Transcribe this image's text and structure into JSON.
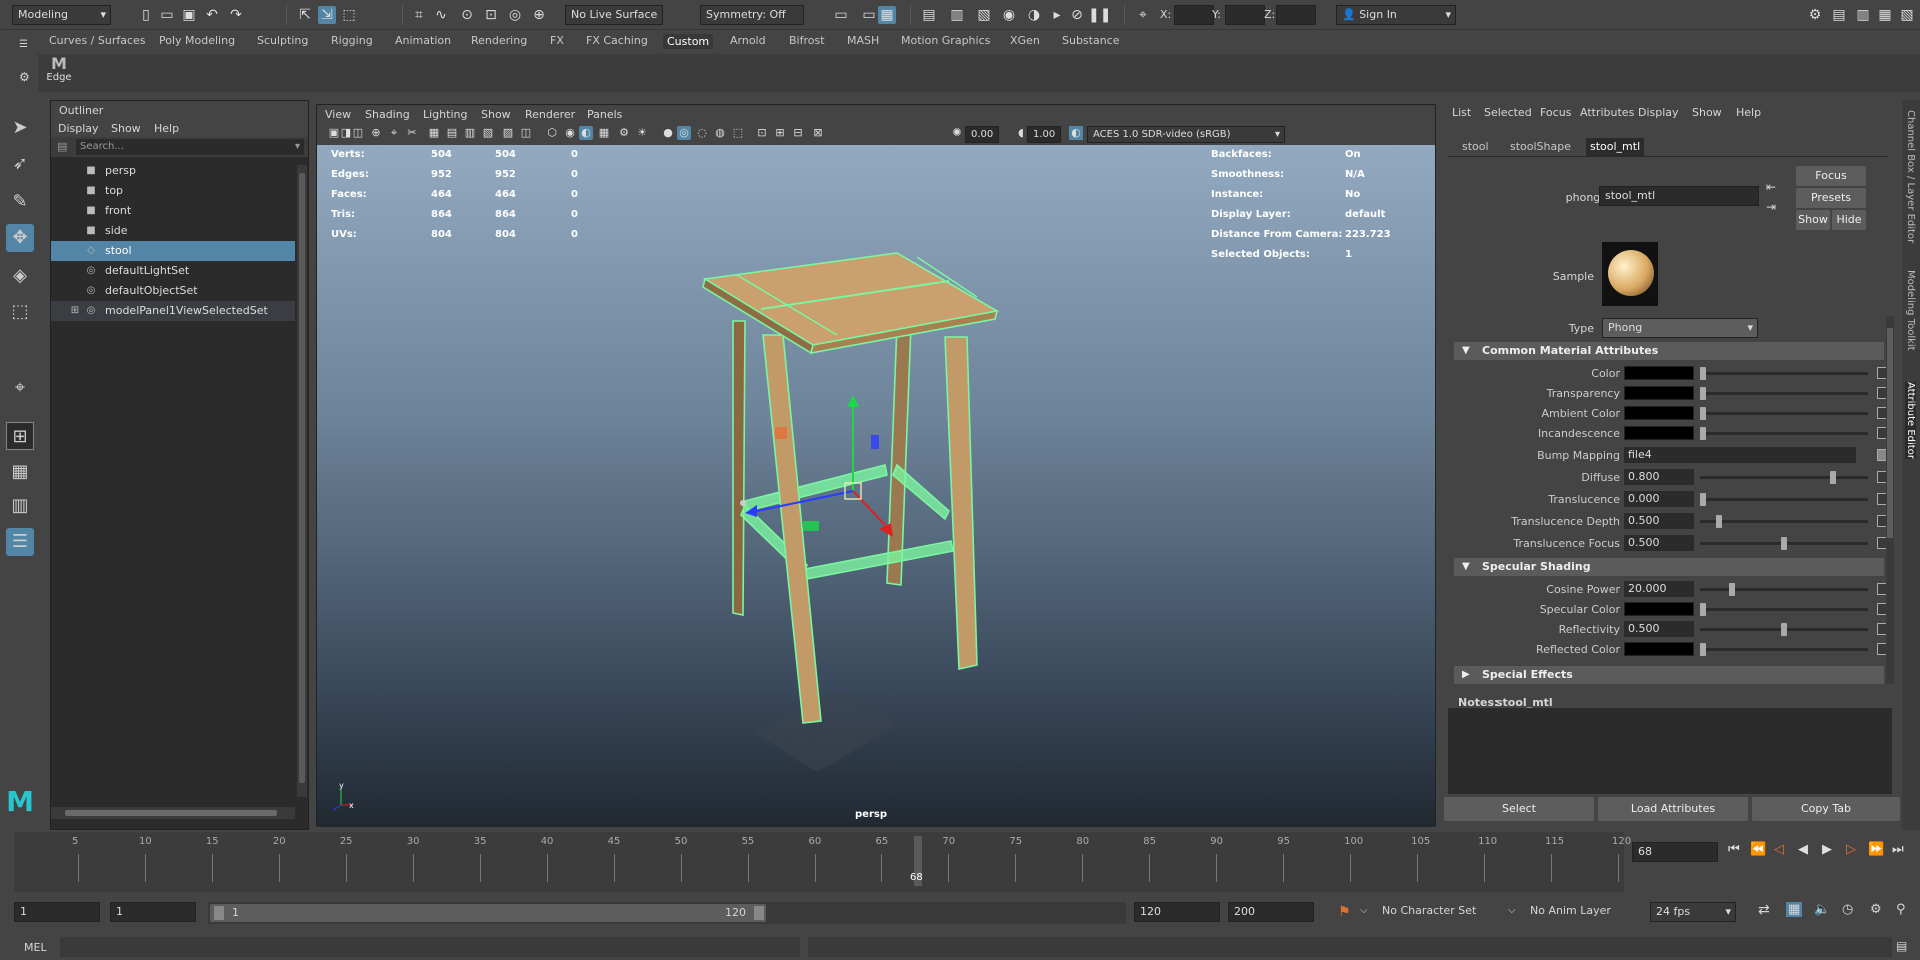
{
  "status_line": {
    "menu_set": "Modeling",
    "live_surface": "No Live Surface",
    "symmetry": "Symmetry: Off",
    "x_label": "X:",
    "y_label": "Y:",
    "z_label": "Z:",
    "sign_in": "Sign In"
  },
  "shelf": {
    "tabs": [
      "Curves / Surfaces",
      "Poly Modeling",
      "Sculpting",
      "Rigging",
      "Animation",
      "Rendering",
      "FX",
      "FX Caching",
      "Custom",
      "Arnold",
      "Bifrost",
      "MASH",
      "Motion Graphics",
      "XGen",
      "Substance"
    ],
    "active_tab": "Custom",
    "edge_button": "Edge"
  },
  "outliner": {
    "title": "Outliner",
    "menu": [
      "Display",
      "Show",
      "Help"
    ],
    "search_placeholder": "Search...",
    "items": [
      {
        "label": "persp",
        "icon": "camera-icon"
      },
      {
        "label": "top",
        "icon": "camera-icon"
      },
      {
        "label": "front",
        "icon": "camera-icon"
      },
      {
        "label": "side",
        "icon": "camera-icon"
      },
      {
        "label": "stool",
        "icon": "mesh-icon"
      },
      {
        "label": "defaultLightSet",
        "icon": "set-icon"
      },
      {
        "label": "defaultObjectSet",
        "icon": "set-icon"
      },
      {
        "label": "modelPanel1ViewSelectedSet",
        "icon": "set-icon"
      }
    ],
    "selected": "stool"
  },
  "viewport": {
    "menu": [
      "View",
      "Shading",
      "Lighting",
      "Show",
      "Renderer",
      "Panels"
    ],
    "exposure": "0.00",
    "gamma": "1.00",
    "color_space": "ACES 1.0 SDR-video (sRGB)",
    "camera": "persp",
    "hud_left": [
      {
        "label": "Verts:",
        "a": "504",
        "b": "504",
        "c": "0"
      },
      {
        "label": "Edges:",
        "a": "952",
        "b": "952",
        "c": "0"
      },
      {
        "label": "Faces:",
        "a": "464",
        "b": "464",
        "c": "0"
      },
      {
        "label": "Tris:",
        "a": "864",
        "b": "864",
        "c": "0"
      },
      {
        "label": "UVs:",
        "a": "804",
        "b": "804",
        "c": "0"
      }
    ],
    "hud_right": [
      {
        "label": "Backfaces:",
        "value": "On"
      },
      {
        "label": "Smoothness:",
        "value": "N/A"
      },
      {
        "label": "Instance:",
        "value": "No"
      },
      {
        "label": "Display Layer:",
        "value": "default"
      },
      {
        "label": "Distance From Camera:",
        "value": "223.723"
      },
      {
        "label": "Selected Objects:",
        "value": "1"
      }
    ],
    "axis_y": "y",
    "axis_x": "x"
  },
  "attribute_editor": {
    "menu": [
      "List",
      "Selected",
      "Focus",
      "Attributes",
      "Display",
      "Show",
      "Help"
    ],
    "tabs": [
      "stool",
      "stoolShape",
      "stool_mtl"
    ],
    "active_tab": "stool_mtl",
    "node_type_label": "phong:",
    "node_name": "stool_mtl",
    "focus": "Focus",
    "presets": "Presets",
    "show": "Show",
    "hide": "Hide",
    "sample_label": "Sample",
    "type_label": "Type",
    "type_value": "Phong",
    "section_common": "Common Material Attributes",
    "section_specular": "Specular Shading",
    "section_effects": "Special Effects",
    "common_attrs": [
      {
        "label": "Color",
        "kind": "color"
      },
      {
        "label": "Transparency",
        "kind": "color"
      },
      {
        "label": "Ambient Color",
        "kind": "color"
      },
      {
        "label": "Incandescence",
        "kind": "color"
      },
      {
        "label": "Bump Mapping",
        "kind": "map",
        "value": "file4"
      },
      {
        "label": "Diffuse",
        "kind": "num",
        "value": "0.800",
        "fraction": 0.8
      },
      {
        "label": "Translucence",
        "kind": "num",
        "value": "0.000",
        "fraction": 0.0
      },
      {
        "label": "Translucence Depth",
        "kind": "num",
        "value": "0.500",
        "fraction": 0.1
      },
      {
        "label": "Translucence Focus",
        "kind": "num",
        "value": "0.500",
        "fraction": 0.5
      }
    ],
    "specular_attrs": [
      {
        "label": "Cosine Power",
        "kind": "num",
        "value": "20.000",
        "fraction": 0.18
      },
      {
        "label": "Specular Color",
        "kind": "color"
      },
      {
        "label": "Reflectivity",
        "kind": "num",
        "value": "0.500",
        "fraction": 0.5
      },
      {
        "label": "Reflected Color",
        "kind": "color"
      }
    ],
    "notes_label": "Notes:",
    "notes_value": "stool_mtl",
    "select_btn": "Select",
    "load_btn": "Load Attributes",
    "copy_btn": "Copy Tab",
    "side_tabs": [
      "Channel Box / Layer Editor",
      "Modeling Toolkit",
      "Attribute Editor"
    ]
  },
  "timeline": {
    "ticks": [
      5,
      10,
      15,
      20,
      25,
      30,
      35,
      40,
      45,
      50,
      55,
      60,
      65,
      70,
      75,
      80,
      85,
      90,
      95,
      100,
      105,
      110,
      115,
      120
    ],
    "current_frame": "68",
    "current_frame_field": "68"
  },
  "range": {
    "start": "1",
    "inner_start": "1",
    "slider_start": "1",
    "slider_end": "120",
    "end": "120",
    "outer_end": "200",
    "character_set": "No Character Set",
    "anim_layer": "No Anim Layer",
    "fps": "24 fps"
  },
  "command_line": {
    "language": "MEL"
  },
  "colors": {
    "accent": "#5285a6",
    "wireframe": "#7cf5a0",
    "wood": "#b58c5a"
  }
}
